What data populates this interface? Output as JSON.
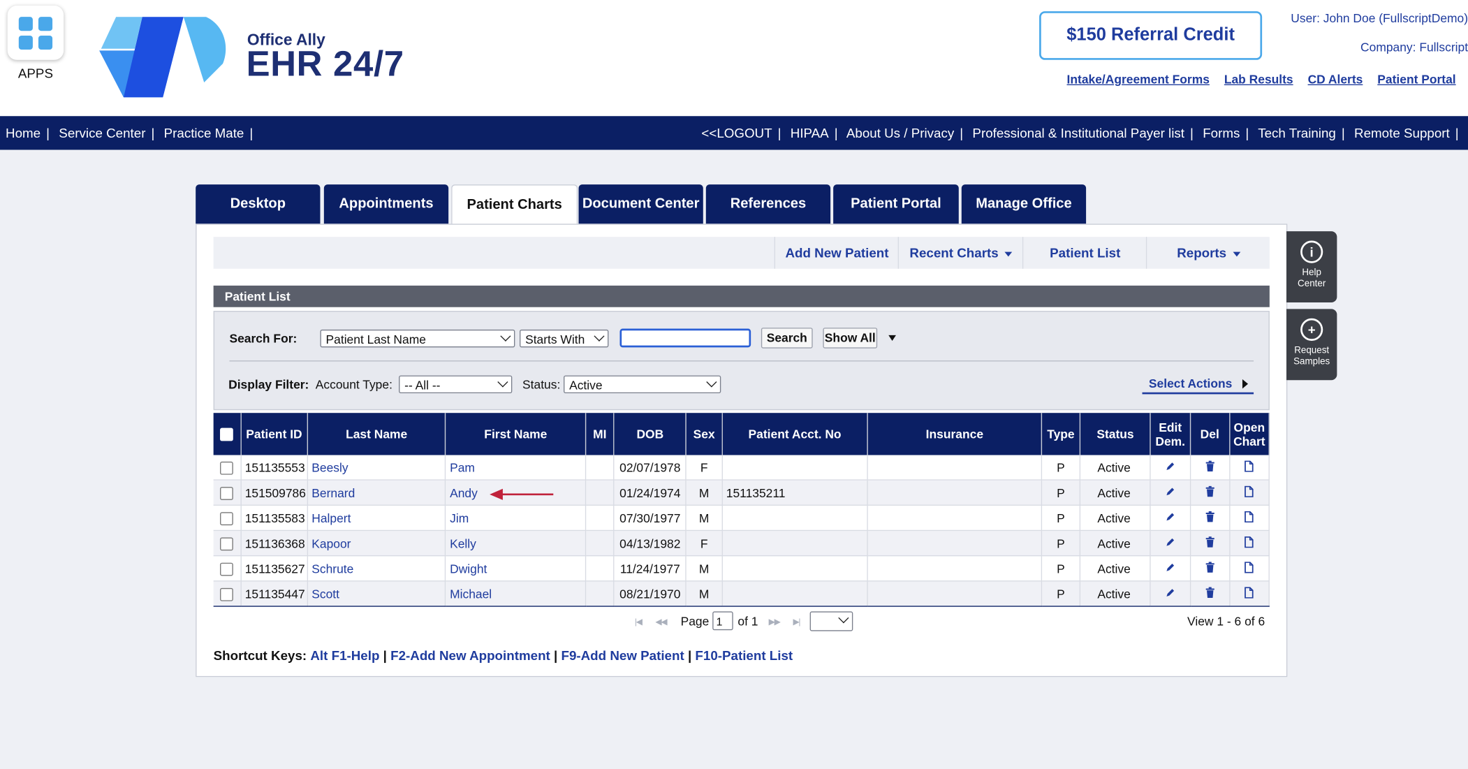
{
  "header": {
    "apps_label": "APPS",
    "logo_small": "Office Ally",
    "logo_big": "EHR 24/7",
    "referral_label": "$150 Referral Credit",
    "user_line": "User: John Doe (FullscriptDemo)",
    "company_line": "Company: Fullscript",
    "links": [
      "Intake/Agreement Forms",
      "Lab Results",
      "CD Alerts",
      "Patient Portal"
    ]
  },
  "topnav": {
    "left": [
      "Home",
      "Service Center",
      "Practice Mate"
    ],
    "right": [
      "<<LOGOUT",
      "HIPAA",
      "About Us / Privacy",
      "Professional & Institutional Payer list",
      "Forms",
      "Tech Training",
      "Remote Support"
    ],
    "separator": "|"
  },
  "tabs": [
    "Desktop",
    "Appointments",
    "Patient Charts",
    "Document Center",
    "References",
    "Patient Portal",
    "Manage Office"
  ],
  "active_tab": "Patient Charts",
  "subnav": [
    "Add New Patient",
    "Recent Charts",
    "Patient List",
    "Reports"
  ],
  "section_title": "Patient List",
  "search": {
    "label": "Search For:",
    "field_value": "Patient Last Name",
    "match_value": "Starts With",
    "query": "",
    "search_button": "Search",
    "show_all_button": "Show All",
    "filter_label": "Display Filter:",
    "account_type_label": "Account Type:",
    "account_type_value": "-- All --",
    "status_label": "Status:",
    "status_value": "Active",
    "select_actions": "Select Actions"
  },
  "table": {
    "headers": [
      "Patient ID",
      "Last Name",
      "First Name",
      "MI",
      "DOB",
      "Sex",
      "Patient Acct. No",
      "Insurance",
      "Type",
      "Status",
      "Edit Dem.",
      "Del",
      "Open Chart"
    ],
    "rows": [
      {
        "id": "151135553",
        "last": "Beesly",
        "first": "Pam",
        "mi": "",
        "dob": "02/07/1978",
        "sex": "F",
        "acct": "",
        "insurance": "",
        "type": "P",
        "status": "Active"
      },
      {
        "id": "151509786",
        "last": "Bernard",
        "first": "Andy",
        "mi": "",
        "dob": "01/24/1974",
        "sex": "M",
        "acct": "151135211",
        "insurance": "",
        "type": "P",
        "status": "Active"
      },
      {
        "id": "151135583",
        "last": "Halpert",
        "first": "Jim",
        "mi": "",
        "dob": "07/30/1977",
        "sex": "M",
        "acct": "",
        "insurance": "",
        "type": "P",
        "status": "Active"
      },
      {
        "id": "151136368",
        "last": "Kapoor",
        "first": "Kelly",
        "mi": "",
        "dob": "04/13/1982",
        "sex": "F",
        "acct": "",
        "insurance": "",
        "type": "P",
        "status": "Active"
      },
      {
        "id": "151135627",
        "last": "Schrute",
        "first": "Dwight",
        "mi": "",
        "dob": "11/24/1977",
        "sex": "M",
        "acct": "",
        "insurance": "",
        "type": "P",
        "status": "Active"
      },
      {
        "id": "151135447",
        "last": "Scott",
        "first": "Michael",
        "mi": "",
        "dob": "08/21/1970",
        "sex": "M",
        "acct": "",
        "insurance": "",
        "type": "P",
        "status": "Active"
      }
    ],
    "highlight_color": "#c0223b"
  },
  "pager": {
    "page_label": "Page",
    "page_value": "1",
    "of_label": "of 1",
    "view_text": "View 1 - 6 of 6"
  },
  "shortcuts": {
    "label": "Shortcut Keys:",
    "items": [
      "Alt F1-Help",
      "F2-Add New Appointment",
      "F9-Add New Patient",
      "F10-Patient List"
    ]
  },
  "side_widgets": {
    "help": "Help Center",
    "samples": "Request Samples"
  },
  "colors": {
    "navy": "#0b1f64",
    "link_blue": "#1f3c9e",
    "accent_blue": "#4aa8ea"
  }
}
